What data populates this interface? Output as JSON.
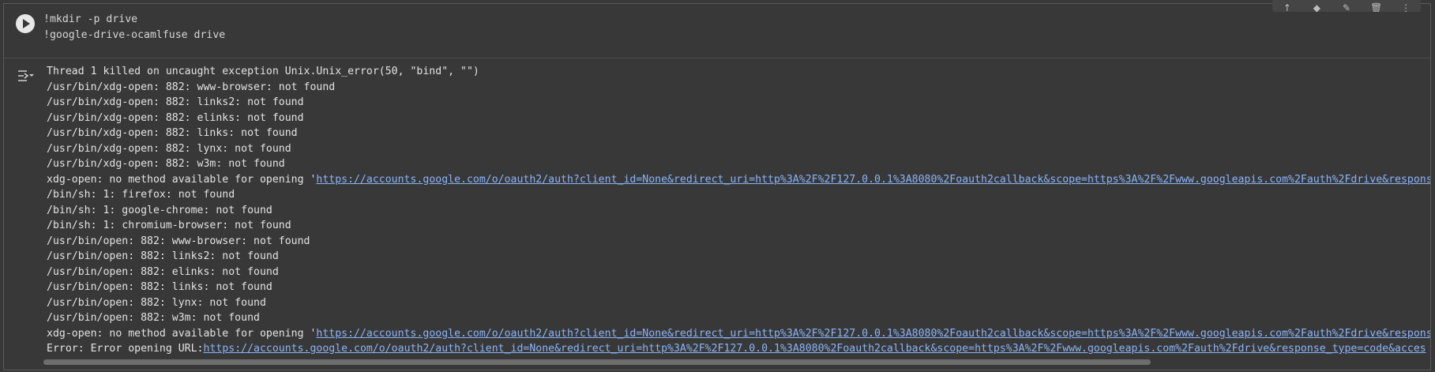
{
  "code": {
    "lines": [
      "!mkdir -p drive",
      "!google-drive-ocamlfuse drive"
    ]
  },
  "toolbar": {
    "icons": [
      "arrow-up-icon",
      "diamond-icon",
      "edit-icon",
      "delete-icon",
      "more-icon"
    ]
  },
  "output": {
    "lines": [
      {
        "text": "Thread 1 killed on uncaught exception Unix.Unix_error(50, \"bind\", \"\")"
      },
      {
        "text": "/usr/bin/xdg-open: 882: www-browser: not found"
      },
      {
        "text": "/usr/bin/xdg-open: 882: links2: not found"
      },
      {
        "text": "/usr/bin/xdg-open: 882: elinks: not found"
      },
      {
        "text": "/usr/bin/xdg-open: 882: links: not found"
      },
      {
        "text": "/usr/bin/xdg-open: 882: lynx: not found"
      },
      {
        "text": "/usr/bin/xdg-open: 882: w3m: not found"
      },
      {
        "text": "xdg-open: no method available for opening '",
        "link": "https://accounts.google.com/o/oauth2/auth?client_id=None&redirect_uri=http%3A%2F%2F127.0.0.1%3A8080%2Foauth2callback&scope=https%3A%2F%2Fwww.googleapis.com%2Fauth%2Fdrive&respons"
      },
      {
        "text": "/bin/sh: 1: firefox: not found"
      },
      {
        "text": "/bin/sh: 1: google-chrome: not found"
      },
      {
        "text": "/bin/sh: 1: chromium-browser: not found"
      },
      {
        "text": "/usr/bin/open: 882: www-browser: not found"
      },
      {
        "text": "/usr/bin/open: 882: links2: not found"
      },
      {
        "text": "/usr/bin/open: 882: elinks: not found"
      },
      {
        "text": "/usr/bin/open: 882: links: not found"
      },
      {
        "text": "/usr/bin/open: 882: lynx: not found"
      },
      {
        "text": "/usr/bin/open: 882: w3m: not found"
      },
      {
        "text": "xdg-open: no method available for opening '",
        "link": "https://accounts.google.com/o/oauth2/auth?client_id=None&redirect_uri=http%3A%2F%2F127.0.0.1%3A8080%2Foauth2callback&scope=https%3A%2F%2Fwww.googleapis.com%2Fauth%2Fdrive&respons"
      },
      {
        "text": "Error: Error opening URL:",
        "link": "https://accounts.google.com/o/oauth2/auth?client_id=None&redirect_uri=http%3A%2F%2F127.0.0.1%3A8080%2Foauth2callback&scope=https%3A%2F%2Fwww.googleapis.com%2Fauth%2Fdrive&response_type=code&acces"
      }
    ]
  },
  "colors": {
    "background": "#383838",
    "text": "#e3e3e3",
    "link": "#8ab4f8"
  }
}
